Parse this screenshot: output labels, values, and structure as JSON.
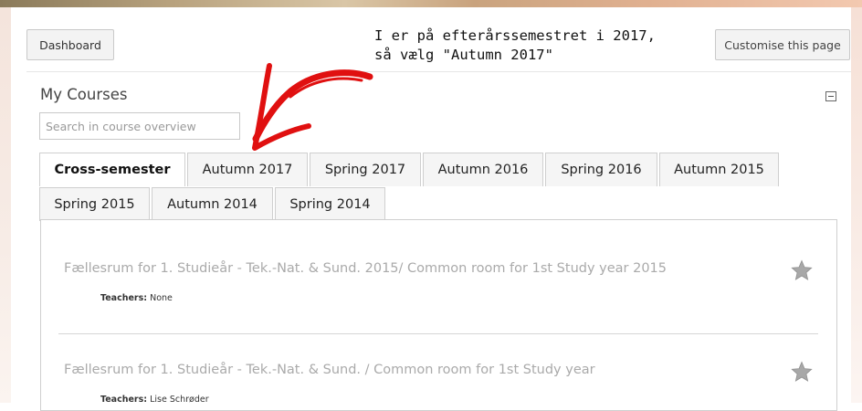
{
  "header": {
    "dashboard_label": "Dashboard",
    "customise_label": "Customise this page"
  },
  "annotation": {
    "line1": "I er på efterårssemestret i 2017,",
    "line2": "så vælg \"Autumn 2017\"",
    "arrow_color": "#e01010"
  },
  "block": {
    "title": "My Courses",
    "search_placeholder": "Search in course overview",
    "search_value": ""
  },
  "tabs": [
    {
      "label": "Cross-semester",
      "active": true
    },
    {
      "label": "Autumn 2017",
      "active": false
    },
    {
      "label": "Spring 2017",
      "active": false
    },
    {
      "label": "Autumn 2016",
      "active": false
    },
    {
      "label": "Spring 2016",
      "active": false
    },
    {
      "label": "Autumn 2015",
      "active": false
    },
    {
      "label": "Spring 2015",
      "active": false
    },
    {
      "label": "Autumn 2014",
      "active": false
    },
    {
      "label": "Spring 2014",
      "active": false
    }
  ],
  "courses": [
    {
      "title": "Fællesrum for 1. Studieår - Tek.-Nat. & Sund. 2015/ Common room for 1st Study year 2015",
      "teachers_label": "Teachers:",
      "teachers_value": "None",
      "icon": "star-icon"
    },
    {
      "title": "Fællesrum for 1. Studieår - Tek.-Nat. & Sund. / Common room for 1st Study year",
      "teachers_label": "Teachers:",
      "teachers_value": "Lise Schrøder",
      "icon": "star-icon"
    }
  ],
  "colors": {
    "course_title": "#aaaaaa",
    "star": "#a8a8a8"
  }
}
